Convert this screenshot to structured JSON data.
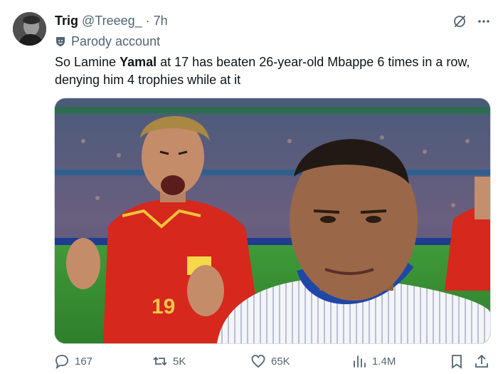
{
  "tweet": {
    "display_name": "Trig",
    "handle": "@Treeeg_",
    "separator": "·",
    "time": "7h",
    "label": "Parody account",
    "text_part1": "So Lamine ",
    "text_bold": "Yamal",
    "text_part2": " at 17 has beaten 26-year-old Mbappe 6 times in a row, denying him 4 trophies while at it"
  },
  "media": {
    "jersey_number": "19"
  },
  "actions": {
    "replies": "167",
    "reposts": "5K",
    "likes": "65K",
    "views": "1.4M"
  },
  "icons": {
    "top": [
      "grok-icon",
      "more-icon"
    ],
    "label": "parody-badge-icon",
    "actions": [
      "reply-icon",
      "repost-icon",
      "like-icon",
      "views-icon",
      "bookmark-icon",
      "share-icon"
    ]
  },
  "colors": {
    "text": "#0f1419",
    "secondary": "#536471",
    "spain_red": "#d6281c",
    "france_blue": "#1f47a8"
  }
}
